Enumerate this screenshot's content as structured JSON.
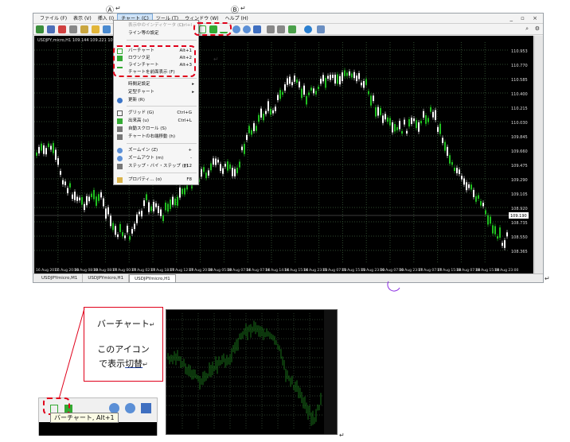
{
  "menubar": {
    "items": [
      "ファイル (F)",
      "表示 (V)",
      "挿入 (I)",
      "チャート (C)",
      "ツール (T)",
      "ウィンドウ (W)",
      "ヘルプ (H)"
    ],
    "active_index": 3,
    "window_controls": "_ ▫ ×"
  },
  "annotations": {
    "label_a": "Ⓐ",
    "label_b": "Ⓑ",
    "pilcrow": "↵"
  },
  "chart": {
    "symbol_caption": "USDJPY,micro,H1  109.144 109.221 109.075 109.206",
    "price_labels": [
      "110.953",
      "110.770",
      "110.585",
      "110.400",
      "110.215",
      "110.030",
      "109.845",
      "109.660",
      "109.475",
      "109.290",
      "109.105",
      "108.920",
      "108.735",
      "108.550",
      "108.365"
    ],
    "current_price": "109.190",
    "time_labels": [
      "16 Aug 2017",
      "16 Aug 20:00",
      "16 Aug 08:00",
      "10 Aug 08:00",
      "17 Aug 00:00",
      "17 Aug 02:00",
      "17 Aug 18:00",
      "17 Aug 12:00",
      "17 Aug 20:00",
      "18 Aug 05:00",
      "18 Aug 07:00",
      "14 Aug 07:00",
      "14 Aug 14:00",
      "14 Aug 15:00",
      "14 Aug 23:00",
      "15 Aug 07:00",
      "15 Aug 15:00",
      "15 Aug 23:00",
      "16 Aug 07:00",
      "16 Aug 23:00",
      "17 Aug 07:00",
      "17 Aug 15:00",
      "18 Aug 07:00",
      "18 Aug 15:00",
      "18 Aug 23:00"
    ],
    "colors": {
      "bull": "#20c020",
      "bear": "#ffffff",
      "grid": "#2f4a2f",
      "background": "#000000"
    }
  },
  "tabs": [
    "USDJPYmicro,M1",
    "USDJPYmicro,H1",
    "USDJPYmicro,H1"
  ],
  "active_tab": 2,
  "menu": {
    "items": [
      {
        "label": "表示中のインディケータ (L)",
        "shortcut": "Ctrl+I",
        "disabled": true
      },
      {
        "label": "ライン等の設定",
        "shortcut": "",
        "disabled": false
      },
      {
        "label": "",
        "shortcut": "",
        "disabled": false
      },
      {
        "label": "バーチャート",
        "shortcut": "Alt+1",
        "disabled": false
      },
      {
        "label": "ロウソク足",
        "shortcut": "Alt+2",
        "disabled": false
      },
      {
        "label": "ラインチャート",
        "shortcut": "Alt+3",
        "disabled": false
      },
      {
        "label": "チャートを前面表示 (F)",
        "shortcut": "",
        "disabled": false
      },
      {
        "label": "時間足設定",
        "shortcut": "▸",
        "disabled": false
      },
      {
        "label": "定型チャート",
        "shortcut": "▸",
        "disabled": false
      },
      {
        "label": "更新 (R)",
        "shortcut": "",
        "disabled": false
      },
      {
        "label": "グリッド (G)",
        "shortcut": "Ctrl+G",
        "disabled": false
      },
      {
        "label": "出来高 (u)",
        "shortcut": "Ctrl+L",
        "disabled": false
      },
      {
        "label": "自動スクロール (S)",
        "shortcut": "",
        "disabled": false
      },
      {
        "label": "チャートの右端移動 (h)",
        "shortcut": "",
        "disabled": false
      },
      {
        "label": "ズームイン (Z)",
        "shortcut": "+",
        "disabled": false
      },
      {
        "label": "ズームアウト (m)",
        "shortcut": "-",
        "disabled": false
      },
      {
        "label": "ステップ・バイ・ステップ (y)",
        "shortcut": "F12",
        "disabled": false
      },
      {
        "label": "プロパティ… (o)",
        "shortcut": "F8",
        "disabled": false
      }
    ]
  },
  "callout": {
    "line1": "バーチャート",
    "line2": "このアイコン",
    "line3_a": "で表示",
    "line3_b": "切替",
    "mark": "↵"
  },
  "tooltip": {
    "text": "バーチャート, Alt+1"
  }
}
